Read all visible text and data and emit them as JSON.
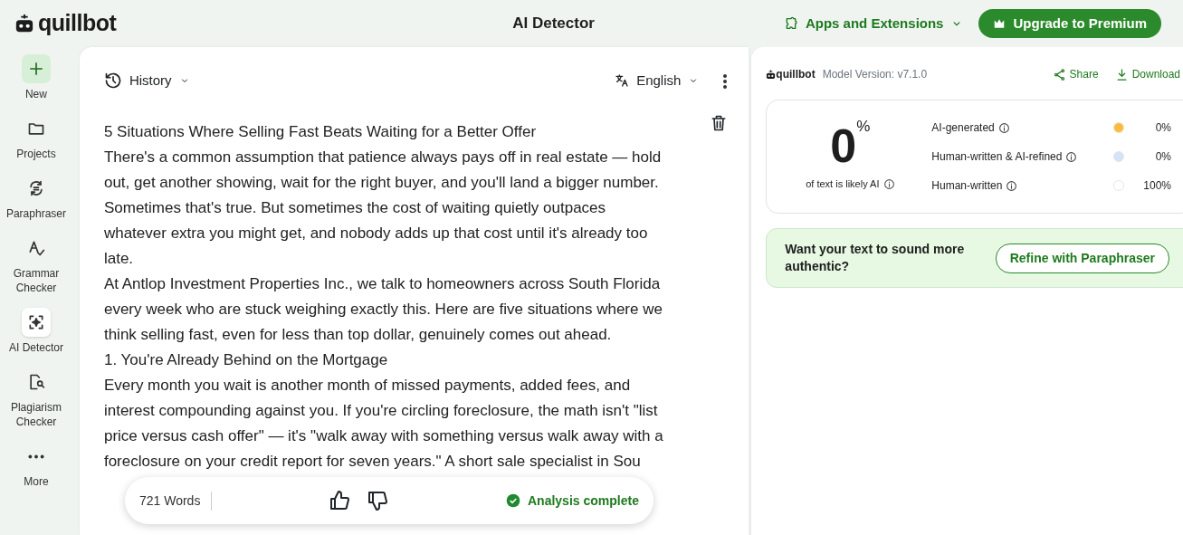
{
  "header": {
    "logo": "quillbot",
    "title": "AI Detector",
    "apps_menu": "Apps and Extensions",
    "upgrade_button": "Upgrade to Premium"
  },
  "sidebar": {
    "new_button": "New",
    "items": [
      {
        "label": "Projects",
        "selected": false
      },
      {
        "label": "Paraphraser",
        "selected": false
      },
      {
        "label": "Grammar Checker",
        "selected": false
      },
      {
        "label": "AI Detector",
        "selected": true
      },
      {
        "label": "Plagiarism Checker",
        "selected": false
      },
      {
        "label": "More",
        "selected": false
      }
    ]
  },
  "editor": {
    "history": "History",
    "language": "English",
    "paragraphs": [
      "5 Situations Where Selling Fast Beats Waiting for a Better Offer",
      "There's a common assumption that patience always pays off in real estate — hold out, get another showing, wait for the right buyer, and you'll land a bigger number. Sometimes that's true. But sometimes the cost of waiting quietly outpaces whatever extra you might get, and nobody adds up that cost until it's already too late.",
      "At Antlop Investment Properties Inc., we talk to homeowners across South Florida every week who are stuck weighing exactly this. Here are five situations where we think selling fast, even for less than top dollar, genuinely comes out ahead.",
      "1. You're Already Behind on the Mortgage",
      "Every month you wait is another month of missed payments, added fees, and interest compounding against you. If you're circling foreclosure, the math isn't \"list price versus cash offer\" — it's \"walk away with something versus walk away with a foreclosure on your credit report for seven years.\" A short sale specialist in Sou"
    ],
    "word_count": "721 Words",
    "status": "Analysis complete"
  },
  "results": {
    "logo": "quillbot",
    "model_version": "Model Version: v7.1.0",
    "share": "Share",
    "download": "Download",
    "score": "0",
    "score_unit": "%",
    "score_caption": "of text is likely AI",
    "categories": [
      {
        "label": "AI-generated",
        "color": "#fbbc3c",
        "value": "0%"
      },
      {
        "label": "Human-written & AI-refined",
        "color": "#d4e3f8",
        "value": "0%"
      },
      {
        "label": "Human-written",
        "color": "#ffffff",
        "value": "100%"
      }
    ],
    "cta": {
      "text": "Want your text to sound more authentic?",
      "button": "Refine with Paraphraser"
    }
  }
}
